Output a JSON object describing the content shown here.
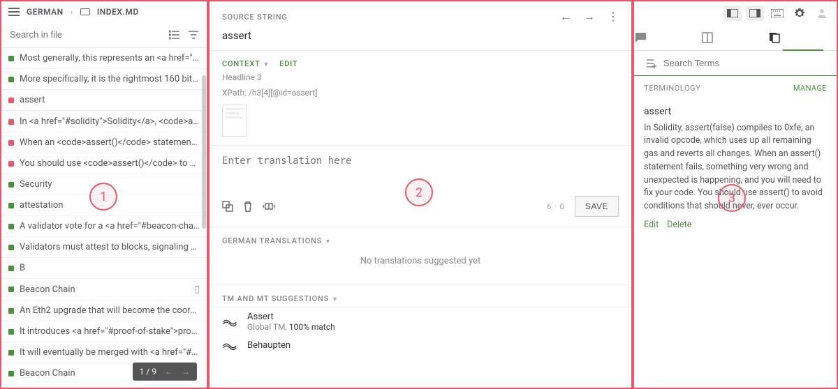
{
  "callouts": [
    "1",
    "2",
    "3"
  ],
  "pane1": {
    "breadcrumb": {
      "lang": "GERMAN",
      "file": "INDEX.MD"
    },
    "search_placeholder": "Search in file",
    "items": [
      {
        "color": "green",
        "text": "Most generally, this represents an <a href=\"#eoa\"..."
      },
      {
        "color": "green",
        "text": "More specifically, it is the rightmost 160 bits of a ..."
      },
      {
        "color": "red",
        "text": "assert",
        "selected": true
      },
      {
        "color": "red",
        "text": "In <a href=\"#solidity\">Solidity</a>, <code>assert(..."
      },
      {
        "color": "red",
        "text": "When an <code>assert()</code> statement fails, ..."
      },
      {
        "color": "red",
        "text": "You should use <code>assert()</code> to avoid c..."
      },
      {
        "color": "green",
        "text": "Security"
      },
      {
        "color": "green",
        "text": "attestation"
      },
      {
        "color": "green",
        "text": "A validator vote for a <a href=\"#beacon-chain\">Be..."
      },
      {
        "color": "green",
        "text": "Validators must attest to blocks, signaling that th..."
      },
      {
        "color": "green",
        "text": "B"
      },
      {
        "color": "green",
        "text": "Beacon Chain",
        "book": true
      },
      {
        "color": "green",
        "text": "An Eth2 upgrade that will become the coordinator..."
      },
      {
        "color": "green",
        "text": "It introduces <a href=\"#proof-of-stake\">proof-of-s..."
      },
      {
        "color": "green",
        "text": "It will eventually be merged with <a href=\"#mainn..."
      },
      {
        "color": "green",
        "text": "Beacon Chain"
      }
    ],
    "pager": "1 / 9"
  },
  "pane2": {
    "source_label": "SOURCE STRING",
    "source_value": "assert",
    "context_label": "CONTEXT",
    "edit_label": "EDIT",
    "context_lines": [
      "Headline 3",
      "XPath: /h3[4][@id=assert]"
    ],
    "translation_placeholder": "Enter translation here",
    "counter": "6 · 0",
    "save": "SAVE",
    "german_label": "GERMAN TRANSLATIONS",
    "german_empty": "No translations suggested yet",
    "tm_label": "TM AND MT SUGGESTIONS",
    "suggestions": [
      {
        "title": "Assert",
        "sub_prefix": "Global TM, ",
        "sub_match": "100% match"
      },
      {
        "title": "Behaupten",
        "sub_prefix": "",
        "sub_match": ""
      }
    ]
  },
  "pane3": {
    "search_placeholder": "Search Terms",
    "terminology_label": "TERMINOLOGY",
    "manage": "MANAGE",
    "term": "assert",
    "definition": "In Solidity, assert(false) compiles to 0xfe, an invalid opcode, which uses up all remaining gas and reverts all changes. When an assert() statement fails, something very wrong and unexpected is happening, and you will need to fix your code. You should use assert() to avoid conditions that should never, ever occur.",
    "edit": "Edit",
    "delete": "Delete"
  }
}
